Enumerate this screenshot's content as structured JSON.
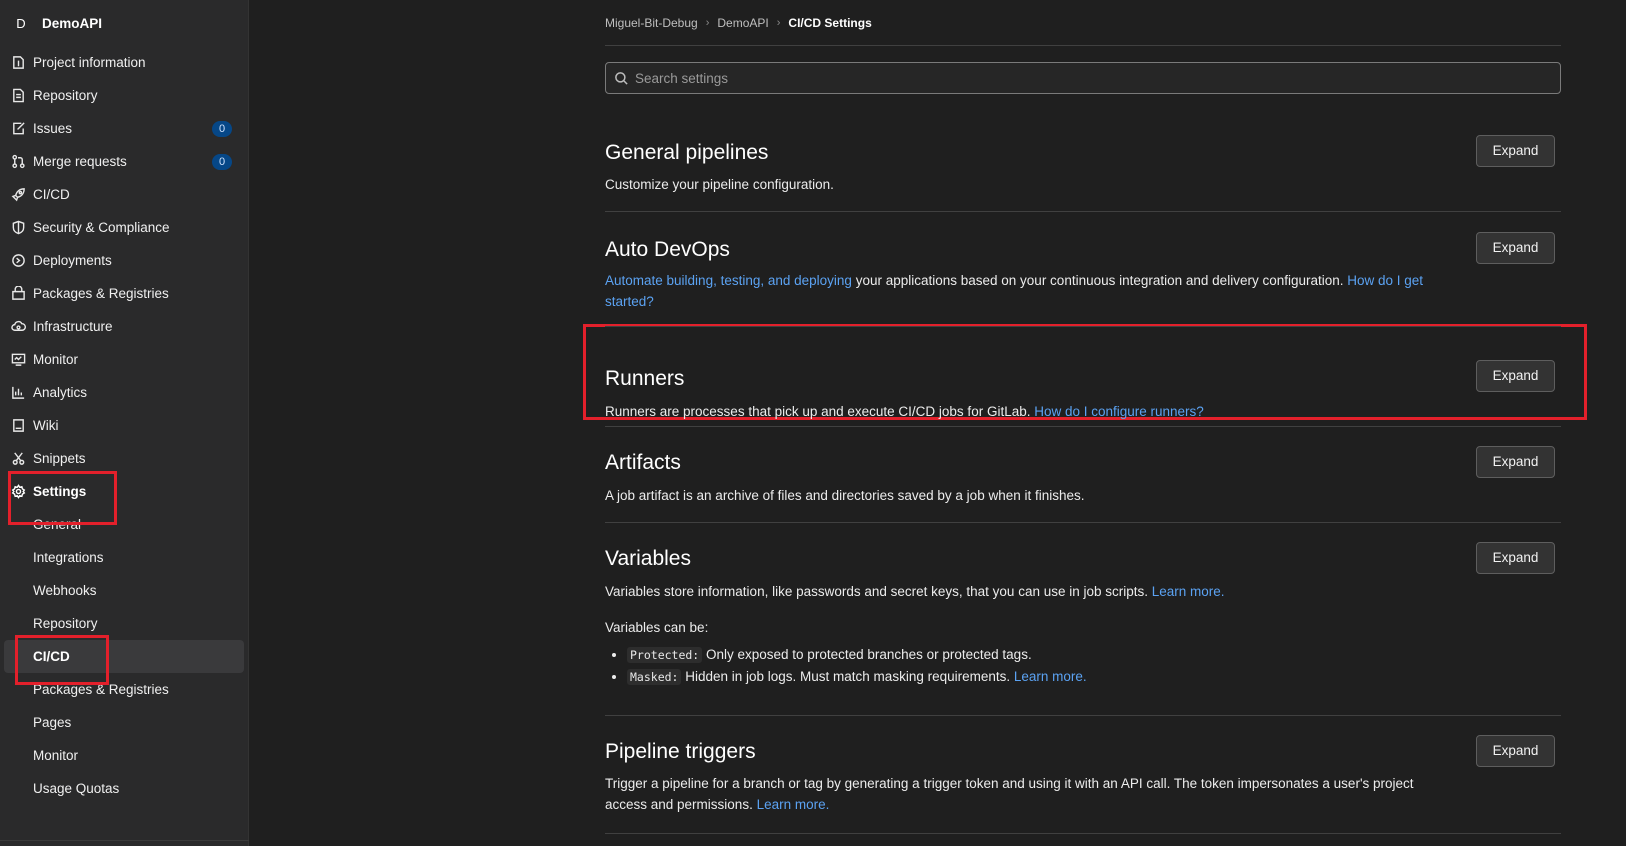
{
  "project": {
    "avatar_letter": "D",
    "name": "DemoAPI"
  },
  "sidebar": {
    "items": [
      {
        "label": "Project information",
        "icon": "info-icon"
      },
      {
        "label": "Repository",
        "icon": "document-icon"
      },
      {
        "label": "Issues",
        "icon": "issues-icon",
        "badge": "0"
      },
      {
        "label": "Merge requests",
        "icon": "merge-request-icon",
        "badge": "0"
      },
      {
        "label": "CI/CD",
        "icon": "rocket-icon"
      },
      {
        "label": "Security & Compliance",
        "icon": "shield-icon"
      },
      {
        "label": "Deployments",
        "icon": "deployments-icon"
      },
      {
        "label": "Packages & Registries",
        "icon": "package-icon"
      },
      {
        "label": "Infrastructure",
        "icon": "cloud-gear-icon"
      },
      {
        "label": "Monitor",
        "icon": "monitor-icon"
      },
      {
        "label": "Analytics",
        "icon": "chart-icon"
      },
      {
        "label": "Wiki",
        "icon": "book-icon"
      },
      {
        "label": "Snippets",
        "icon": "scissors-icon"
      },
      {
        "label": "Settings",
        "icon": "gear-icon"
      }
    ],
    "settings_sub": [
      {
        "label": "General"
      },
      {
        "label": "Integrations"
      },
      {
        "label": "Webhooks"
      },
      {
        "label": "Repository"
      },
      {
        "label": "CI/CD",
        "active": true
      },
      {
        "label": "Packages & Registries"
      },
      {
        "label": "Pages"
      },
      {
        "label": "Monitor"
      },
      {
        "label": "Usage Quotas"
      }
    ]
  },
  "breadcrumb": {
    "items": [
      "Miguel-Bit-Debug",
      "DemoAPI"
    ],
    "current": "CI/CD Settings"
  },
  "search": {
    "placeholder": "Search settings"
  },
  "expand_label": "Expand",
  "sections": {
    "general": {
      "title": "General pipelines",
      "desc": "Customize your pipeline configuration."
    },
    "autodevops": {
      "title": "Auto DevOps",
      "link1": "Automate building, testing, and deploying",
      "text": " your applications based on your continuous integration and delivery configuration. ",
      "link2": "How do I get started?"
    },
    "runners": {
      "title": "Runners",
      "text": "Runners are processes that pick up and execute CI/CD jobs for GitLab. ",
      "link": "How do I configure runners?"
    },
    "artifacts": {
      "title": "Artifacts",
      "desc": "A job artifact is an archive of files and directories saved by a job when it finishes."
    },
    "variables": {
      "title": "Variables",
      "text": "Variables store information, like passwords and secret keys, that you can use in job scripts. ",
      "link": "Learn more.",
      "can_be": "Variables can be:",
      "protected_code": "Protected:",
      "protected_text": " Only exposed to protected branches or protected tags.",
      "masked_code": "Masked:",
      "masked_text": " Hidden in job logs. Must match masking requirements. ",
      "masked_link": "Learn more."
    },
    "triggers": {
      "title": "Pipeline triggers",
      "text": "Trigger a pipeline for a branch or tag by generating a trigger token and using it with an API call. The token impersonates a user's project access and permissions. ",
      "link": "Learn more."
    }
  },
  "colors": {
    "annotation": "#e3202b",
    "link": "#5ba2f2",
    "badge_bg": "#064787"
  }
}
